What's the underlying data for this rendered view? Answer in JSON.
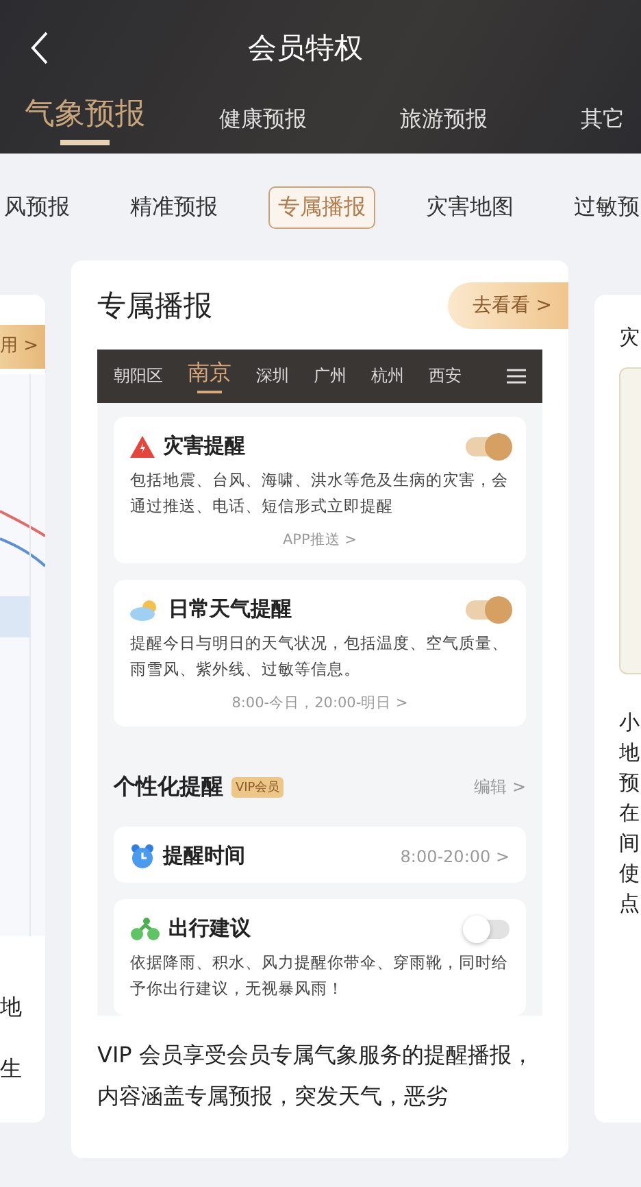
{
  "nav": {
    "title": "会员特权"
  },
  "main_tabs": [
    {
      "label": "气象预报",
      "selected": true
    },
    {
      "label": "健康预报",
      "selected": false
    },
    {
      "label": "旅游预报",
      "selected": false
    },
    {
      "label": "其它",
      "selected": false
    }
  ],
  "sub_tabs": [
    {
      "label": "风预报",
      "selected": false
    },
    {
      "label": "精准预报",
      "selected": false
    },
    {
      "label": "专属播报",
      "selected": true
    },
    {
      "label": "灾害地图",
      "selected": false
    },
    {
      "label": "过敏预",
      "selected": false
    }
  ],
  "left_card": {
    "badge": "用 >",
    "lines": [
      "地",
      "生"
    ]
  },
  "center_card": {
    "title": "专属播报",
    "action": "去看看 >",
    "cities": [
      {
        "label": "朝阳区",
        "selected": false
      },
      {
        "label": "南京",
        "selected": true
      },
      {
        "label": "深圳",
        "selected": false
      },
      {
        "label": "广州",
        "selected": false
      },
      {
        "label": "杭州",
        "selected": false
      },
      {
        "label": "西安",
        "selected": false
      }
    ],
    "alerts": [
      {
        "kind": "toggle",
        "title": "灾害提醒",
        "on": true,
        "desc": "包括地震、台风、海啸、洪水等危及生病的灾害，会通过推送、电话、短信形式立即提醒",
        "link": "APP推送 >"
      },
      {
        "kind": "toggle",
        "title": "日常天气提醒",
        "on": true,
        "desc": "提醒今日与明日的天气状况，包括温度、空气质量、雨雪风、紫外线、过敏等信息。",
        "link": "8:00-今日，20:00-明日 >"
      }
    ],
    "section": {
      "title": "个性化提醒",
      "badge": "VIP会员",
      "action": "编辑 >"
    },
    "personal": [
      {
        "kind": "value",
        "title": "提醒时间",
        "value": "8:00-20:00 >"
      },
      {
        "kind": "toggle",
        "title": "出行建议",
        "on": false,
        "desc": "依据降雨、积水、风力提醒你带伞、穿雨靴，同时给予你出行建议，无视暴风雨！"
      }
    ],
    "description": "VIP 会员享受会员专属气象服务的提醒播报，内容涵盖专属预报，突发天气，恶劣"
  },
  "right_card": {
    "title": "灾",
    "lines": [
      "小",
      "地",
      "预",
      "在",
      "间",
      "使",
      "点"
    ]
  }
}
